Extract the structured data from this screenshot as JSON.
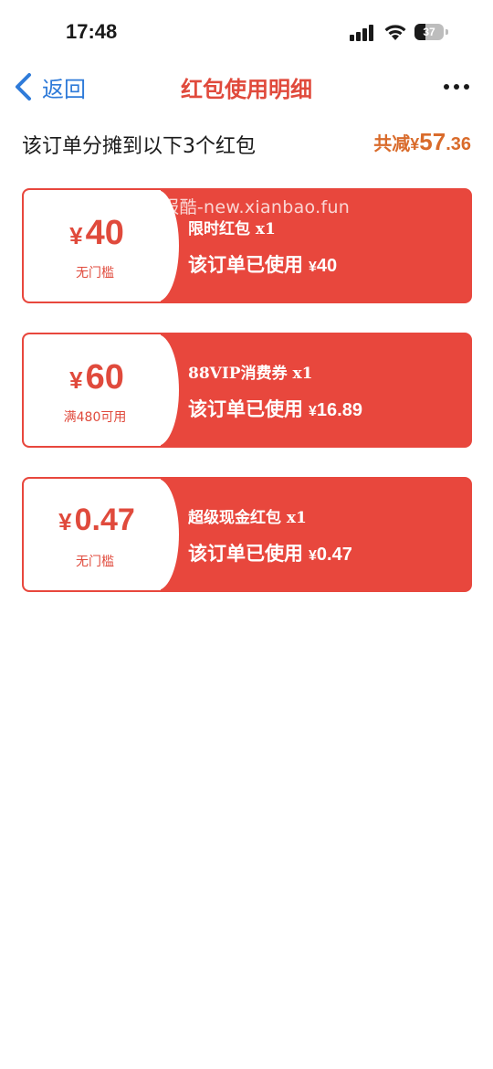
{
  "status_bar": {
    "time": "17:48",
    "battery": "37",
    "battery_fraction": 0.37
  },
  "nav": {
    "back_label": "返回",
    "title": "红包使用明细"
  },
  "summary": {
    "text": "该订单分摊到以下3个红包",
    "label": "共减",
    "currency": "¥",
    "amount_int": "57",
    "amount_dec": ".36"
  },
  "watermark": "线报酷-new.xianbao.fun",
  "cards": [
    {
      "currency": "¥",
      "amount": "40",
      "condition": "无门槛",
      "name": "限时红包 x1",
      "used_label": "该订单已使用",
      "used_currency": "¥",
      "used_amount": "40"
    },
    {
      "currency": "¥",
      "amount": "60",
      "condition": "满480可用",
      "name": "88VIP消费券 x1",
      "used_label": "该订单已使用",
      "used_currency": "¥",
      "used_amount": "16.89"
    },
    {
      "currency": "¥",
      "amount": "0.47",
      "condition": "无门槛",
      "name": "超级现金红包 x1",
      "used_label": "该订单已使用",
      "used_currency": "¥",
      "used_amount": "0.47"
    }
  ],
  "colors": {
    "accent": "#e8473d",
    "title": "#e04a3c",
    "link": "#2f7bd9",
    "total": "#d96b2b"
  }
}
